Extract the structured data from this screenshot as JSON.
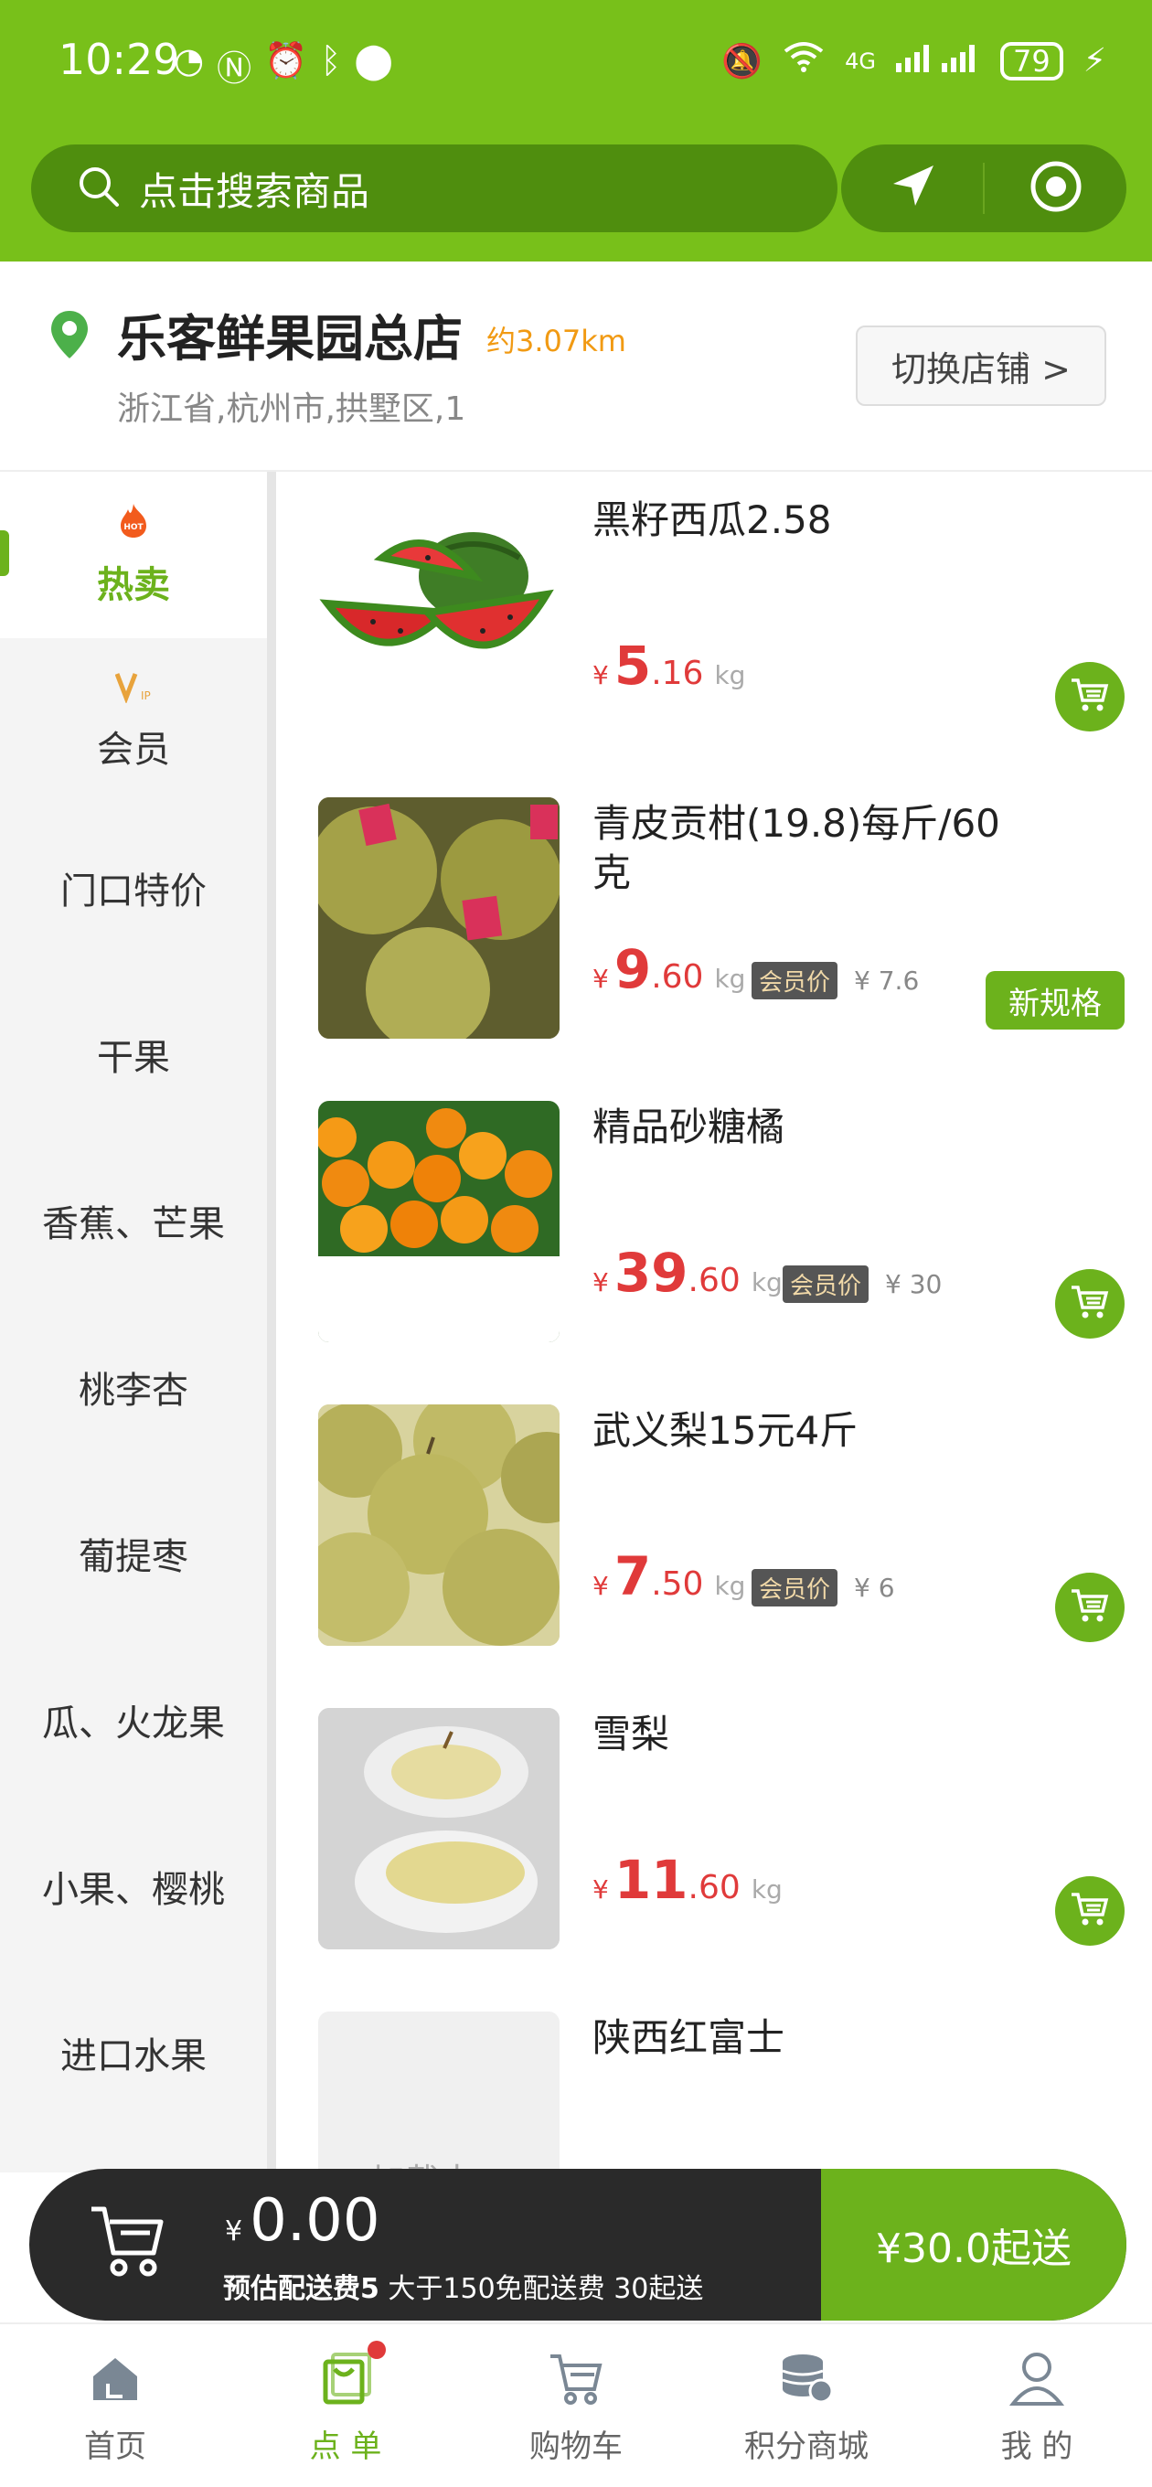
{
  "status_bar": {
    "time": "10:29",
    "battery": "79",
    "network": "4G"
  },
  "search": {
    "placeholder": "点击搜索商品"
  },
  "store": {
    "name": "乐客鲜果园总店",
    "distance": "约3.07km",
    "address": "浙江省,杭州市,拱墅区,1",
    "switch_label": "切换店铺 >"
  },
  "sidebar": {
    "items": [
      {
        "label": "热卖",
        "icon": "hot-icon",
        "active": true
      },
      {
        "label": "会员",
        "icon": "vip-icon"
      },
      {
        "label": "门口特价"
      },
      {
        "label": "干果"
      },
      {
        "label": "香蕉、芒果"
      },
      {
        "label": "桃李杏"
      },
      {
        "label": "葡提枣"
      },
      {
        "label": "瓜、火龙果"
      },
      {
        "label": "小果、樱桃"
      },
      {
        "label": "进口水果"
      }
    ],
    "hot_badge": "HOT"
  },
  "products": [
    {
      "title": "黑籽西瓜2.58",
      "currency": "¥",
      "price_int": "5",
      "price_dec": ".16",
      "unit": "kg",
      "action": "cart"
    },
    {
      "title": "青皮贡柑(19.8)每斤/60克",
      "currency": "¥",
      "price_int": "9",
      "price_dec": ".60",
      "unit": "kg",
      "member_tag": "会员价",
      "member_price": "¥ 7.6",
      "action": "spec",
      "spec_label": "新规格"
    },
    {
      "title": "精品砂糖橘",
      "currency": "¥",
      "price_int": "39",
      "price_dec": ".60",
      "unit": "kg",
      "member_tag": "会员价",
      "member_price": "¥ 30",
      "action": "cart"
    },
    {
      "title": "武义梨15元4斤",
      "currency": "¥",
      "price_int": "7",
      "price_dec": ".50",
      "unit": "kg",
      "member_tag": "会员价",
      "member_price": "¥ 6",
      "action": "cart"
    },
    {
      "title": "雪梨",
      "currency": "¥",
      "price_int": "11",
      "price_dec": ".60",
      "unit": "kg",
      "action": "cart"
    },
    {
      "title": "陕西红富士",
      "loading": "加载中..."
    }
  ],
  "cart_bar": {
    "currency": "¥",
    "total": "0.00",
    "fee_bold": "预估配送费5",
    "fee_rest": " 大于150免配送费 30起送",
    "checkout": "¥30.0起送"
  },
  "tabs": [
    {
      "label": "首页",
      "icon": "home-icon"
    },
    {
      "label": "点 单",
      "icon": "order-icon",
      "active": true
    },
    {
      "label": "购物车",
      "icon": "cart-icon"
    },
    {
      "label": "积分商城",
      "icon": "points-mall-icon"
    },
    {
      "label": "我 的",
      "icon": "profile-icon"
    }
  ],
  "colors": {
    "brand_green": "#78c01a",
    "price_red": "#e03a3a",
    "distance_orange": "#f19a13"
  }
}
